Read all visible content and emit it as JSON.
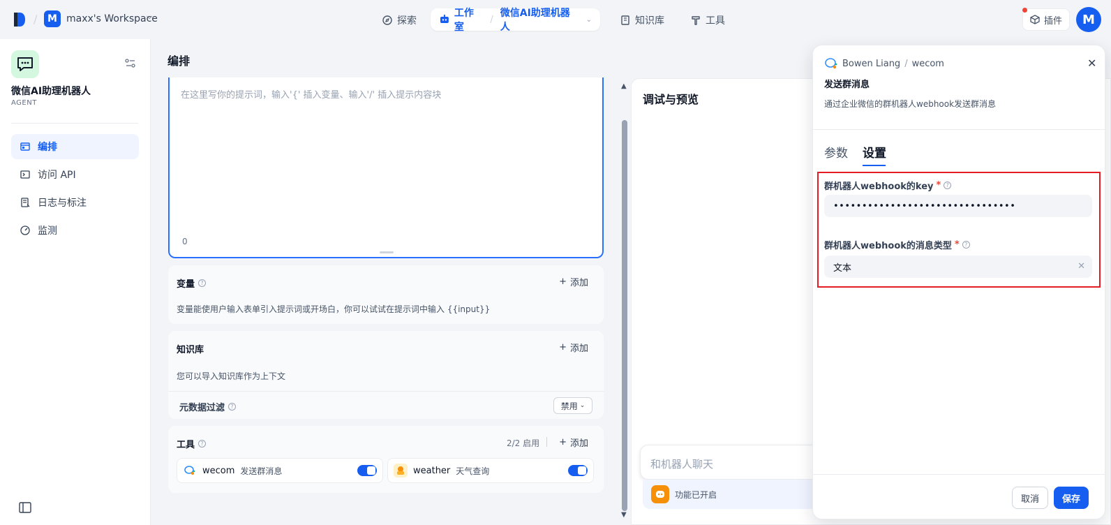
{
  "topbar": {
    "workspace_initial": "M",
    "workspace_name": "maxx's Workspace",
    "nav": {
      "explore": "探索",
      "studio": "工作室",
      "app_name": "微信AI助理机器人",
      "knowledge": "知识库",
      "tools": "工具"
    },
    "plugins_label": "插件",
    "user_initial": "M"
  },
  "sidebar": {
    "app_name": "微信AI助理机器人",
    "app_type": "AGENT",
    "items": [
      {
        "label": "编排",
        "icon": "layout-icon",
        "active": true
      },
      {
        "label": "访问 API",
        "icon": "terminal-icon",
        "active": false
      },
      {
        "label": "日志与标注",
        "icon": "log-icon",
        "active": false
      },
      {
        "label": "监测",
        "icon": "gauge-icon",
        "active": false
      }
    ]
  },
  "main": {
    "title": "编排",
    "prompt": {
      "placeholder": "在这里写你的提示词，输入'{' 插入变量、输入'/' 插入提示内容块",
      "char_count": "0"
    },
    "variables": {
      "title": "变量",
      "add_label": "添加",
      "desc": "变量能使用户输入表单引入提示词或开场白，你可以试试在提示词中输入 {{input}}"
    },
    "knowledge": {
      "title": "知识库",
      "add_label": "添加",
      "desc": "您可以导入知识库作为上下文",
      "metadata_label": "元数据过滤",
      "metadata_value": "禁用"
    },
    "tools": {
      "title": "工具",
      "count": "2/2 启用",
      "add_label": "添加",
      "items": [
        {
          "name": "wecom",
          "desc": "发送群消息",
          "enabled": true,
          "icon": "wecom-icon"
        },
        {
          "name": "weather",
          "desc": "天气查询",
          "enabled": true,
          "icon": "weather-icon"
        }
      ]
    }
  },
  "debug": {
    "title": "调试与预览",
    "chat_placeholder": "和机器人聊天",
    "feature_label": "功能已开启"
  },
  "drawer": {
    "author": "Bowen Liang",
    "provider": "wecom",
    "title": "发送群消息",
    "desc": "通过企业微信的群机器人webhook发送群消息",
    "tabs": [
      "参数",
      "设置"
    ],
    "active_tab": "设置",
    "fields": [
      {
        "label": "群机器人webhook的key",
        "value": "••••••••••••••••••••••••••••••••",
        "required": true
      },
      {
        "label": "群机器人webhook的消息类型",
        "value": "文本",
        "required": true
      }
    ],
    "cancel_label": "取消",
    "save_label": "保存",
    "highlight_color": "#e41c24",
    "accent_color": "#155eef"
  }
}
